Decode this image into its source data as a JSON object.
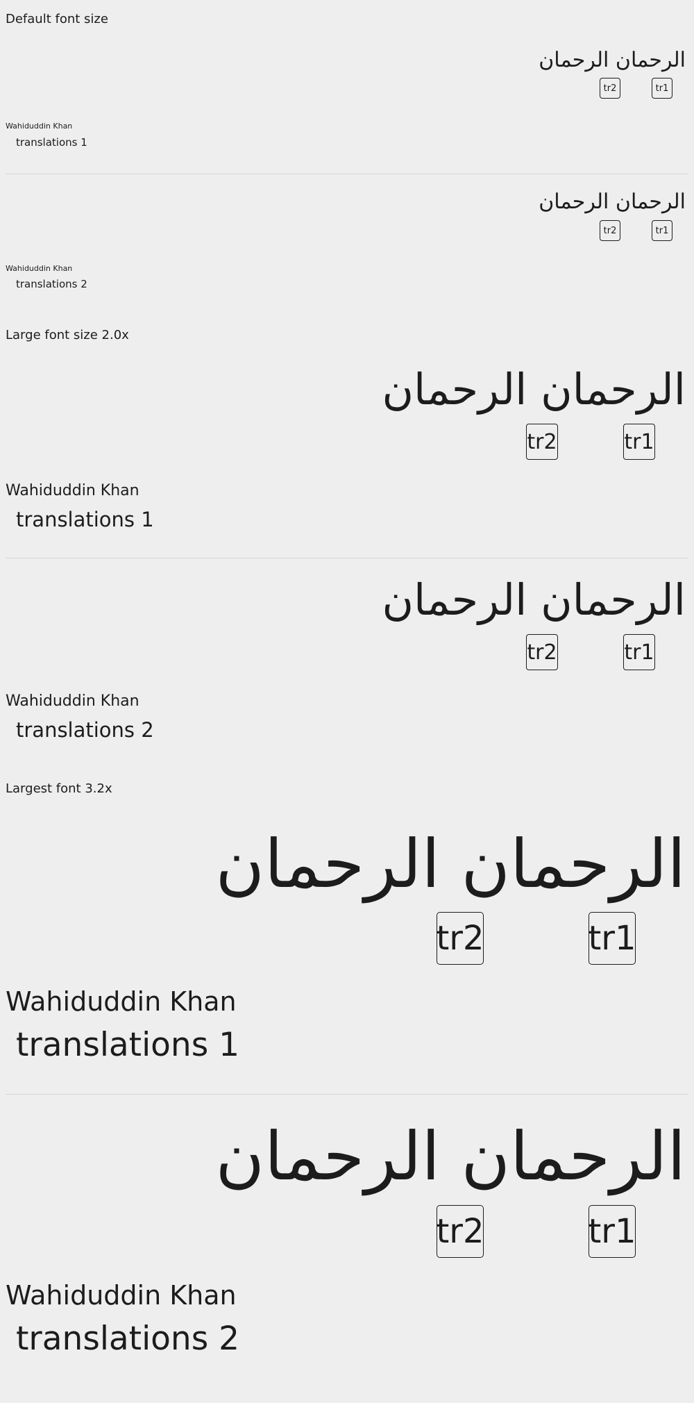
{
  "sections": [
    {
      "heading": "Default font size",
      "cards": [
        {
          "arabic_words": [
            "الرحمان",
            "الرحمان"
          ],
          "tags": [
            "tr1",
            "tr2"
          ],
          "author": "Wahiduddin Khan",
          "translation": "translations 1"
        },
        {
          "arabic_words": [
            "الرحمان",
            "الرحمان"
          ],
          "tags": [
            "tr1",
            "tr2"
          ],
          "author": "Wahiduddin Khan",
          "translation": "translations 2"
        }
      ]
    },
    {
      "heading": "Large font size 2.0x",
      "cards": [
        {
          "arabic_words": [
            "الرحمان",
            "الرحمان"
          ],
          "tags": [
            "tr1",
            "tr2"
          ],
          "author": "Wahiduddin Khan",
          "translation": "translations 1"
        },
        {
          "arabic_words": [
            "الرحمان",
            "الرحمان"
          ],
          "tags": [
            "tr1",
            "tr2"
          ],
          "author": "Wahiduddin Khan",
          "translation": "translations 2"
        }
      ]
    },
    {
      "heading": "Largest font 3.2x",
      "cards": [
        {
          "arabic_words": [
            "الرحمان",
            "الرحمان"
          ],
          "tags": [
            "tr1",
            "tr2"
          ],
          "author": "Wahiduddin Khan",
          "translation": "translations 1"
        },
        {
          "arabic_words": [
            "الرحمان",
            "الرحمان"
          ],
          "tags": [
            "tr1",
            "tr2"
          ],
          "author": "Wahiduddin Khan",
          "translation": "translations 2"
        }
      ]
    }
  ]
}
